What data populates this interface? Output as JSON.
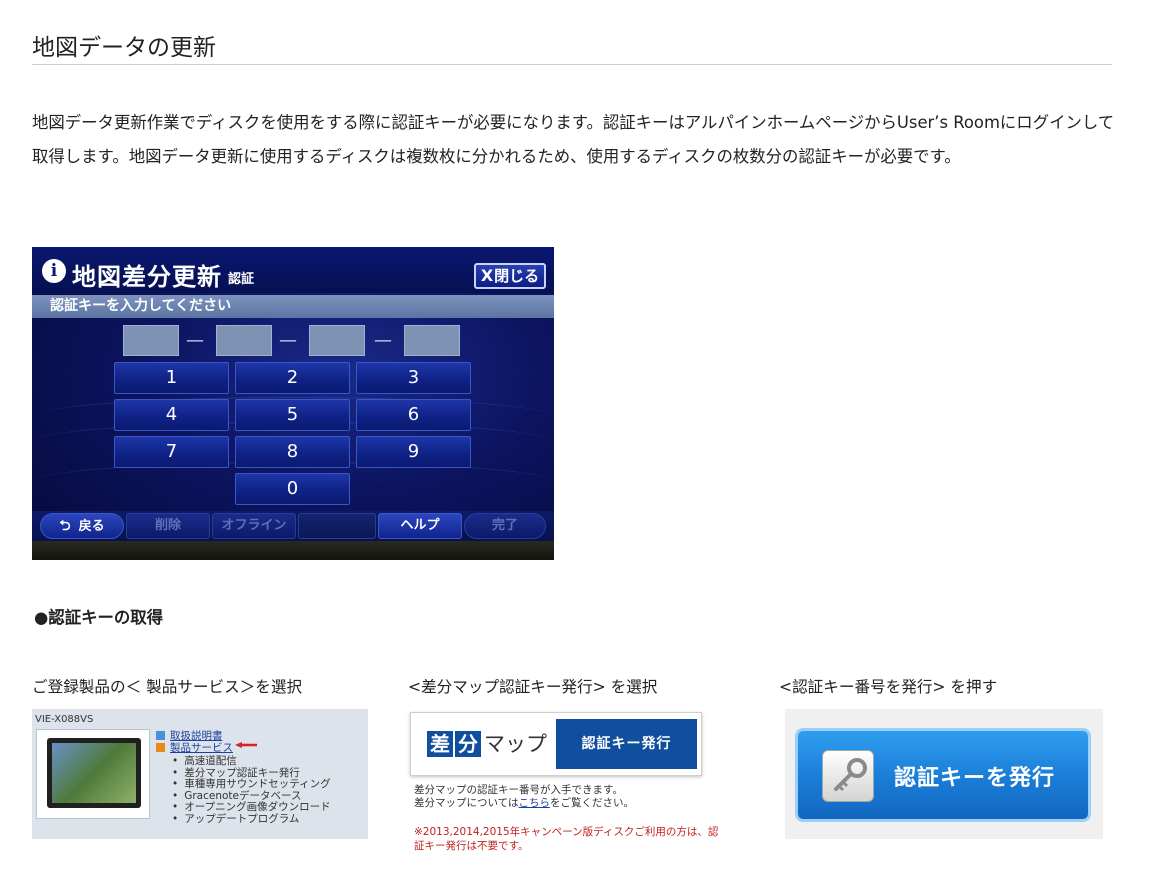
{
  "page": {
    "title": "地図データの更新",
    "intro": "地図データ更新作業でディスクを使用をする際に認証キーが必要になります。認証キーはアルパインホームページからUser’s Roomにログインして取得します。地図データ更新に使用するディスクは複数枚に分かれるため、使用するディスクの枚数分の認証キーが必要です。"
  },
  "nav_screen": {
    "info_icon": "i",
    "title": "地図差分更新",
    "subtitle": "認証",
    "close_x": "X",
    "close_label": "閉じる",
    "instruction": "認証キーを入力してください",
    "dash": "—",
    "keys": [
      "1",
      "2",
      "3",
      "4",
      "5",
      "6",
      "7",
      "8",
      "9",
      "0"
    ],
    "bottom": {
      "back_arrow": "⮌",
      "back": "戻る",
      "delete": "削除",
      "offline": "オフライン",
      "help": "ヘルプ",
      "done": "完了"
    }
  },
  "section": {
    "heading": "●認証キーの取得"
  },
  "steps": [
    {
      "caption": "ご登録製品の＜ 製品サービス＞を選択"
    },
    {
      "caption": "<差分マップ認証キー発行> を選択"
    },
    {
      "caption": "<認証キー番号を発行> を押す"
    }
  ],
  "panel1": {
    "model": "VIE-X088VS",
    "link_manual": "取扱説明書",
    "link_service": "製品サービス",
    "items": [
      "高速道配信",
      "差分マップ認証キー発行",
      "車種専用サウンドセッティング",
      "Gracenoteデータベース",
      "オープニング画像ダウンロード",
      "アップデートプログラム"
    ],
    "colors": {
      "link_blue": "#1a3f9e",
      "arrow_red": "#d8202a",
      "square_blue": "#4a90d9",
      "square_orange": "#e88a1a"
    }
  },
  "panel2": {
    "sa": "差",
    "bun": "分",
    "map": "マップ",
    "issue": "認証キー発行",
    "note_line1": "差分マップの認証キー番号が入手できます。",
    "note_line2_pre": "差分マップについては",
    "note_link": "こちら",
    "note_line2_post": "をご覧ください。",
    "warning": "※2013,2014,2015年キャンペーン版ディスクご利用の方は、認証キー発行は不要です。"
  },
  "panel3": {
    "label": "認証キーを発行",
    "icon": "key-icon"
  }
}
